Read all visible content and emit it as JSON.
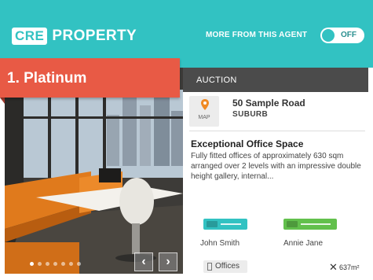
{
  "header": {
    "logo_box": "CRE",
    "logo_text": "PROPERTY",
    "agent_label": "MORE FROM THIS AGENT",
    "toggle_label": "OFF",
    "background": "#32c2c2"
  },
  "ribbon": {
    "label": "1. Platinum",
    "color": "#e85a45"
  },
  "gallery": {
    "dot_count": 7,
    "active_dot": 1,
    "prev_icon": "chevron-left-icon",
    "next_icon": "chevron-right-icon",
    "prev_label": "‹",
    "next_label": "›"
  },
  "listing": {
    "sale_type": "AUCTION",
    "map_label": "MAP",
    "address_line1": "50 Sample Road",
    "address_line2": "SUBURB",
    "title": "Exceptional Office Space",
    "description": "Fully fitted offices of approximately 630 sqm arranged over 2 levels with an impressive double height gallery, internal...",
    "property_type": "Offices",
    "size": "637m²"
  },
  "agents": [
    {
      "name": "John Smith",
      "brand_color": "#32c2c2"
    },
    {
      "name": "Annie Jane",
      "brand_color": "#62c04c"
    }
  ]
}
